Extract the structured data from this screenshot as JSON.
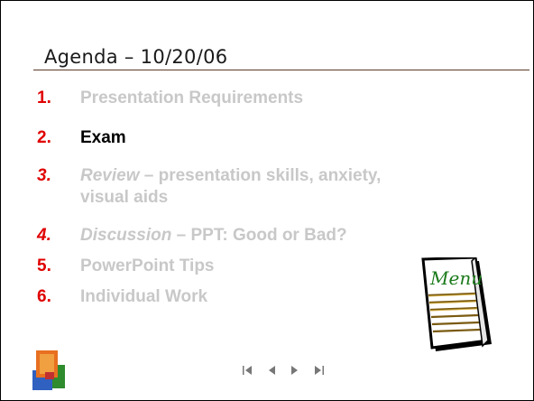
{
  "slide": {
    "title": "Agenda – 10/20/06",
    "items": [
      {
        "number": "1.",
        "text": "Presentation Requirements",
        "state": "dim"
      },
      {
        "number": "2.",
        "text": "Exam",
        "state": "current"
      },
      {
        "number": "3.",
        "emphasis": "Review",
        "text": " – presentation skills, anxiety,",
        "text2": "visual aids",
        "state": "dim"
      },
      {
        "number": "4.",
        "emphasis": "Discussion",
        "text": " – PPT: Good or Bad?",
        "state": "dim"
      },
      {
        "number": "5.",
        "text": "PowerPoint Tips",
        "state": "dim"
      },
      {
        "number": "6.",
        "text": "Individual Work",
        "state": "dim"
      }
    ],
    "menu_card": {
      "label": "Menu",
      "icon": "menu-card-icon"
    },
    "logo": {
      "icon": "office-logo-icon"
    }
  },
  "nav": {
    "buttons": [
      {
        "icon": "first-slide-icon"
      },
      {
        "icon": "previous-slide-icon"
      },
      {
        "icon": "next-slide-icon"
      },
      {
        "icon": "last-slide-icon"
      }
    ]
  },
  "colors": {
    "number": "#e00000",
    "dim_text": "#c8c8c8",
    "current_text": "#000000",
    "title_rule": "#5a3a2a"
  }
}
